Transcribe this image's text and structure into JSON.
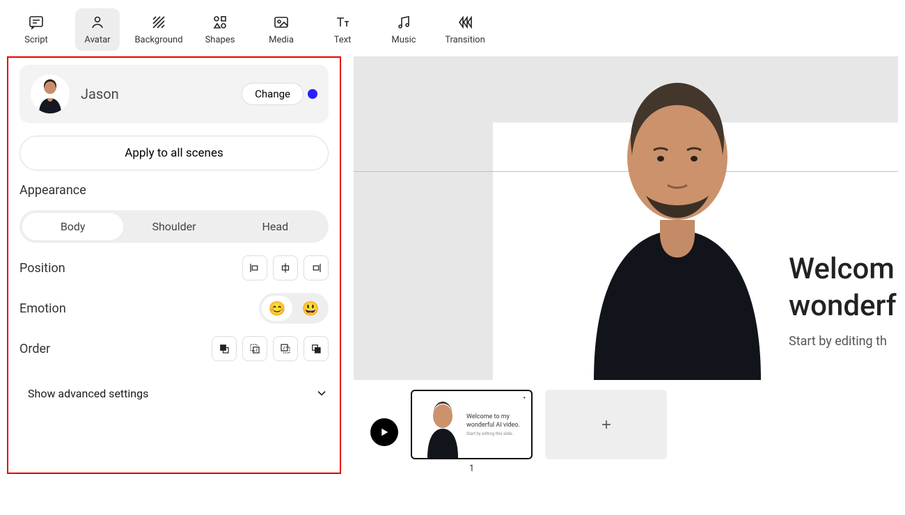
{
  "toolbar": {
    "items": [
      {
        "key": "script",
        "label": "Script"
      },
      {
        "key": "avatar",
        "label": "Avatar"
      },
      {
        "key": "background",
        "label": "Background"
      },
      {
        "key": "shapes",
        "label": "Shapes"
      },
      {
        "key": "media",
        "label": "Media"
      },
      {
        "key": "text",
        "label": "Text"
      },
      {
        "key": "music",
        "label": "Music"
      },
      {
        "key": "transition",
        "label": "Transition"
      }
    ],
    "active": "avatar"
  },
  "panel": {
    "avatar_name": "Jason",
    "change_label": "Change",
    "apply_label": "Apply to all scenes",
    "appearance_label": "Appearance",
    "appearance_opts": [
      "Body",
      "Shoulder",
      "Head"
    ],
    "appearance_selected": "Body",
    "position_label": "Position",
    "emotion_label": "Emotion",
    "emotion_opts": [
      "😊",
      "😃"
    ],
    "emotion_selected": 0,
    "order_label": "Order",
    "advanced_label": "Show advanced settings"
  },
  "canvas": {
    "heading_line1": "Welcom",
    "heading_line2": "wonderf",
    "sub": "Start by editing th"
  },
  "timeline": {
    "scene1_num": "1",
    "thumb_heading": "Welcome to my wonderful AI video.",
    "thumb_sub": "Start by editing this slide."
  }
}
